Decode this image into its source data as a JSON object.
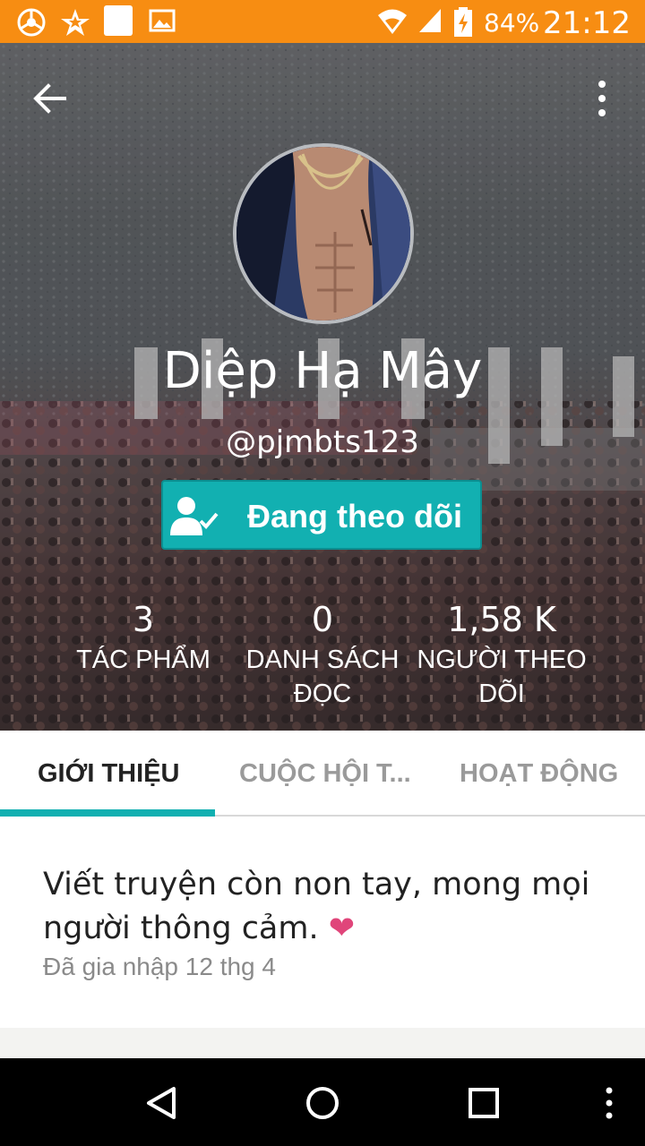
{
  "status_bar": {
    "battery_percent": "84%",
    "time": "21:12",
    "icons": [
      "chrome-icon",
      "star-notification-icon",
      "blank-notification-icon",
      "image-notification-icon",
      "wifi-icon",
      "signal-icon",
      "battery-charging-icon"
    ]
  },
  "header": {
    "back_icon": "arrow-left-icon",
    "more_icon": "more-vertical-icon",
    "name": "Diệp Hạ Mây",
    "handle": "@pjmbts123",
    "follow_button_label": "Đang theo dõi",
    "follow_icon": "person-check-icon"
  },
  "stats": [
    {
      "value": "3",
      "label_line1": "TÁC PHẨM",
      "label_line2": ""
    },
    {
      "value": "0",
      "label_line1": "DANH SÁCH",
      "label_line2": "ĐỌC"
    },
    {
      "value": "1,58 K",
      "label_line1": "NGƯỜI THEO",
      "label_line2": "DÕI"
    }
  ],
  "tabs": [
    {
      "label": "GIỚI THIỆU",
      "active": true
    },
    {
      "label": "CUỘC HỘI T...",
      "active": false
    },
    {
      "label": "HOẠT ĐỘNG",
      "active": false
    }
  ],
  "about": {
    "bio": "Viết truyện còn non tay, mong mọi người thông cảm.",
    "heart": "❤",
    "joined": "Đã gia nhập 12 thg 4"
  },
  "nav_bar": [
    "back-triangle-icon",
    "home-circle-icon",
    "recents-square-icon",
    "more-vertical-icon"
  ],
  "colors": {
    "status_bar": "#f78d12",
    "accent": "#12b0b1",
    "heart": "#e0457a"
  }
}
